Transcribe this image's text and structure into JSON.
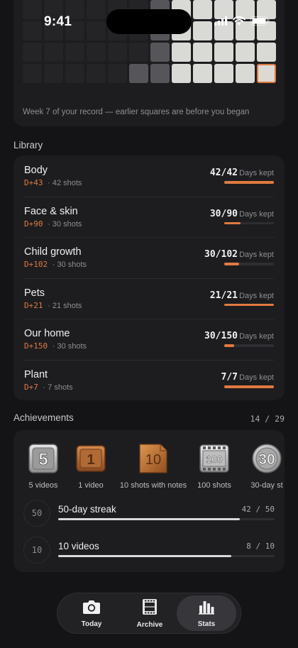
{
  "status": {
    "time": "9:41"
  },
  "heatmap": {
    "caption": "Week 7 of your record — earlier squares are before you began",
    "rows": [
      [
        0,
        0,
        0,
        0,
        0,
        0,
        1,
        2,
        2,
        2,
        2,
        2
      ],
      [
        0,
        0,
        0,
        0,
        0,
        0,
        1,
        2,
        2,
        2,
        2,
        2
      ],
      [
        0,
        0,
        0,
        0,
        0,
        0,
        1,
        2,
        2,
        2,
        2,
        2
      ],
      [
        0,
        0,
        0,
        0,
        0,
        1,
        1,
        2,
        2,
        2,
        2,
        3
      ]
    ]
  },
  "library": {
    "title": "Library",
    "items": [
      {
        "name": "Body",
        "day": "D+43",
        "shots": "· 42 shots",
        "count": "42/42",
        "days_label": "Days kept",
        "progress": 1.0
      },
      {
        "name": "Face & skin",
        "day": "D+90",
        "shots": "· 30 shots",
        "count": "30/90",
        "days_label": "Days kept",
        "progress": 0.333
      },
      {
        "name": "Child growth",
        "day": "D+102",
        "shots": "· 30 shots",
        "count": "30/102",
        "days_label": "Days kept",
        "progress": 0.294
      },
      {
        "name": "Pets",
        "day": "D+21",
        "shots": "· 21 shots",
        "count": "21/21",
        "days_label": "Days kept",
        "progress": 1.0
      },
      {
        "name": "Our home",
        "day": "D+150",
        "shots": "· 30 shots",
        "count": "30/150",
        "days_label": "Days kept",
        "progress": 0.2
      },
      {
        "name": "Plant",
        "day": "D+7",
        "shots": "· 7 shots",
        "count": "7/7",
        "days_label": "Days kept",
        "progress": 1.0
      }
    ]
  },
  "achievements": {
    "title": "Achievements",
    "count": "14 / 29",
    "badges": [
      {
        "number": "5",
        "label": "5 videos",
        "style": "silver"
      },
      {
        "number": "1",
        "label": "1 video",
        "style": "bronze"
      },
      {
        "number": "10",
        "label": "10 shots with notes",
        "style": "bronze-doc"
      },
      {
        "number": "100",
        "label": "100 shots",
        "style": "silver-film"
      },
      {
        "number": "30",
        "label": "30-day st",
        "style": "silver-circle"
      }
    ],
    "progress": [
      {
        "badge": "50",
        "title": "50-day streak",
        "count": "42 / 50",
        "progress": 0.84
      },
      {
        "badge": "10",
        "title": "10 videos",
        "count": "8 / 10",
        "progress": 0.8
      }
    ]
  },
  "nav": {
    "items": [
      {
        "label": "Today",
        "icon": "camera-icon",
        "active": false
      },
      {
        "label": "Archive",
        "icon": "film-icon",
        "active": false
      },
      {
        "label": "Stats",
        "icon": "bar-chart-icon",
        "active": true
      }
    ]
  },
  "colors": {
    "accent": "#e07a3f",
    "bg": "#141416",
    "card": "#1d1d20"
  }
}
